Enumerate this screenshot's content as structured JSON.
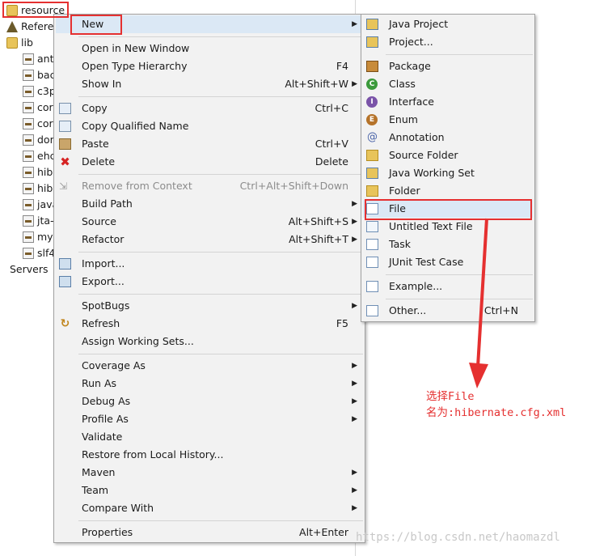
{
  "tree": {
    "resource": "resource",
    "refs": "Refere",
    "lib": "lib",
    "jars": [
      "ant",
      "bac",
      "c3p",
      "cor",
      "cor",
      "dor",
      "ehc",
      "hib",
      "hib",
      "java",
      "jta-",
      "mys",
      "slf4"
    ],
    "servers": "Servers"
  },
  "main_menu": {
    "new": "New",
    "open_new_window": "Open in New Window",
    "open_type_hierarchy": "Open Type Hierarchy",
    "open_type_hierarchy_key": "F4",
    "show_in": "Show In",
    "show_in_key": "Alt+Shift+W",
    "copy": "Copy",
    "copy_key": "Ctrl+C",
    "copy_qualified": "Copy Qualified Name",
    "paste": "Paste",
    "paste_key": "Ctrl+V",
    "delete": "Delete",
    "delete_key": "Delete",
    "remove_context": "Remove from Context",
    "remove_context_key": "Ctrl+Alt+Shift+Down",
    "build_path": "Build Path",
    "source": "Source",
    "source_key": "Alt+Shift+S",
    "refactor": "Refactor",
    "refactor_key": "Alt+Shift+T",
    "import": "Import...",
    "export": "Export...",
    "spotbugs": "SpotBugs",
    "refresh": "Refresh",
    "refresh_key": "F5",
    "assign_ws": "Assign Working Sets...",
    "coverage": "Coverage As",
    "run": "Run As",
    "debug": "Debug As",
    "profile": "Profile As",
    "validate": "Validate",
    "restore": "Restore from Local History...",
    "maven": "Maven",
    "team": "Team",
    "compare": "Compare With",
    "properties": "Properties",
    "properties_key": "Alt+Enter"
  },
  "sub_menu": {
    "java_project": "Java Project",
    "project": "Project...",
    "package": "Package",
    "class": "Class",
    "interface": "Interface",
    "enum": "Enum",
    "annotation": "Annotation",
    "source_folder": "Source Folder",
    "working_set": "Java Working Set",
    "folder": "Folder",
    "file": "File",
    "untitled": "Untitled Text File",
    "task": "Task",
    "junit": "JUnit Test Case",
    "example": "Example...",
    "other": "Other...",
    "other_key": "Ctrl+N"
  },
  "annotation": {
    "line1": "选择File",
    "line2": "名为:hibernate.cfg.xml"
  },
  "watermark": "https://blog.csdn.net/haomazdl",
  "colors": {
    "highlight": "#e53030",
    "menu_bg": "#f2f2f2",
    "hover_bg": "#dbe8f5"
  }
}
